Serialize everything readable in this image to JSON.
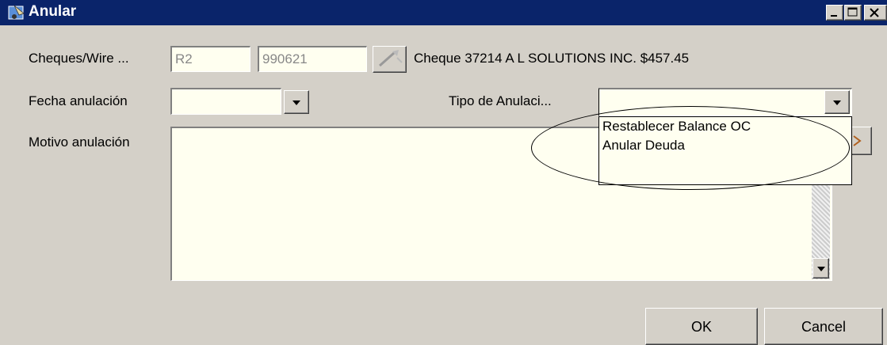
{
  "window": {
    "title": "Anular"
  },
  "form": {
    "cheques_label": "Cheques/Wire ...",
    "cheque_field1": "R2",
    "cheque_field2": "990621",
    "cheque_info": "Cheque 37214 A L SOLUTIONS INC. $457.45",
    "fecha_label": "Fecha anulación",
    "fecha_value": "",
    "tipo_label": "Tipo de Anulaci...",
    "tipo_value": "",
    "motivo_label": "Motivo anulación",
    "motivo_value": ""
  },
  "dropdown": {
    "options": [
      "Restablecer Balance OC",
      "Anular Deuda"
    ]
  },
  "buttons": {
    "ok": "OK",
    "cancel": "Cancel"
  },
  "icons": {
    "window": "app-icon",
    "lookup": "wand-lookup-icon"
  },
  "colors": {
    "titlebar": "#0a246a",
    "field_bg": "#fffff0",
    "face": "#d4d0c8"
  }
}
